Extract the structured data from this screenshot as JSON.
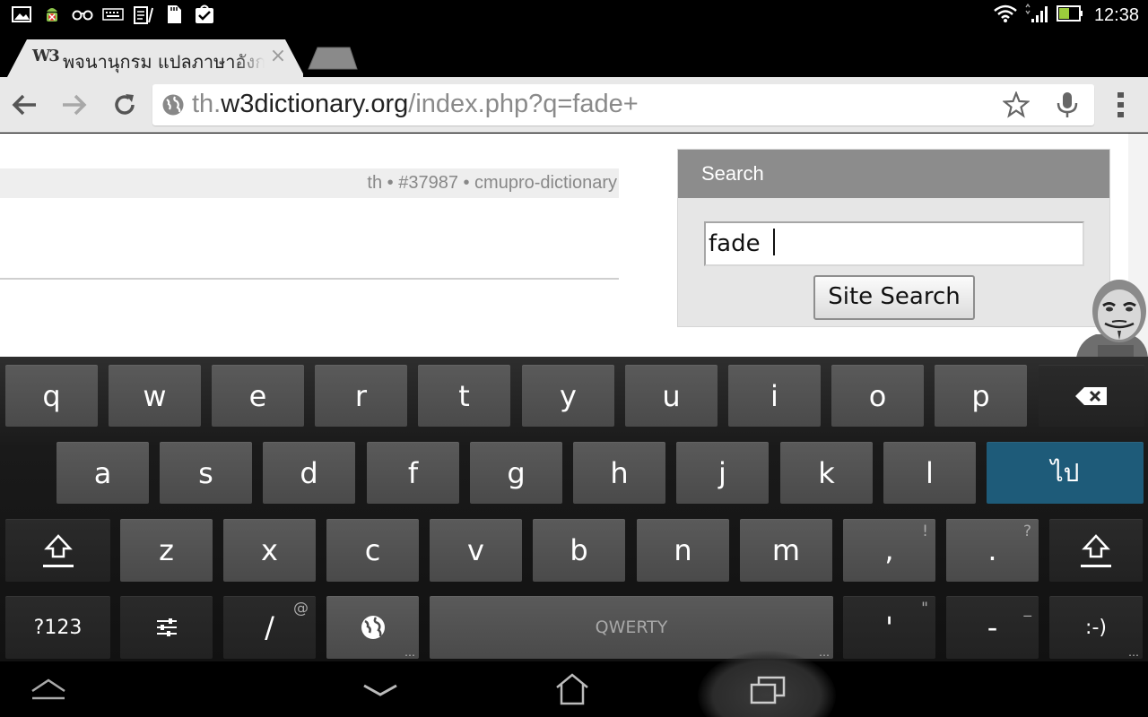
{
  "status_bar": {
    "clock": "12:38",
    "icons": [
      "gallery-icon",
      "android-bug-icon",
      "glasses-icon",
      "keyboard-icon",
      "clipboard-icon",
      "sd-card-icon",
      "checkbox-bag-icon"
    ],
    "right_icons": [
      "wifi-icon",
      "signal-icon",
      "battery-icon"
    ]
  },
  "browser": {
    "tab": {
      "favicon": "W3",
      "title": "พจนานุกรม แปลภาษาอังกฤษ"
    },
    "toolbar": {
      "url_prefix": "th.",
      "url_host": "w3dictionary.org",
      "url_path": "/index.php?q=fade+"
    }
  },
  "page": {
    "entry_meta": "th • #37987 • cmupro-dictionary",
    "search": {
      "heading": "Search",
      "input_value": "fade ",
      "button_label": "Site Search"
    }
  },
  "keyboard": {
    "row1": [
      "q",
      "w",
      "e",
      "r",
      "t",
      "y",
      "u",
      "i",
      "o",
      "p"
    ],
    "row2": [
      "a",
      "s",
      "d",
      "f",
      "g",
      "h",
      "j",
      "k",
      "l"
    ],
    "go_label": "ไป",
    "row3": [
      "z",
      "x",
      "c",
      "v",
      "b",
      "n",
      "m"
    ],
    "comma": ",",
    "comma_hint": "!",
    "period": ".",
    "period_hint": "?",
    "symbols_label": "?123",
    "slash": "/",
    "slash_hint": "@",
    "space_label": "QWERTY",
    "apostrophe": "'",
    "apostrophe_hint": "\"",
    "dash": "-",
    "dash_hint": "_",
    "smiley": ":-)"
  },
  "colors": {
    "go_key": "#1e5b79",
    "search_heading_bg": "#8c8c8c",
    "toolbar_bg": "#e8e8e8"
  }
}
